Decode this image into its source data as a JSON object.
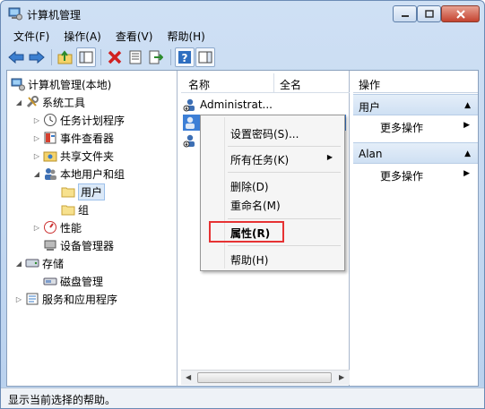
{
  "window": {
    "title": "计算机管理"
  },
  "menubar": [
    "文件(F)",
    "操作(A)",
    "查看(V)",
    "帮助(H)"
  ],
  "tree": {
    "root": "计算机管理(本地)",
    "system_tools": "系统工具",
    "task_scheduler": "任务计划程序",
    "event_viewer": "事件查看器",
    "shared_folders": "共享文件夹",
    "local_users": "本地用户和组",
    "users": "用户",
    "groups": "组",
    "performance": "性能",
    "device_manager": "设备管理器",
    "storage": "存储",
    "disk_management": "磁盘管理",
    "services_apps": "服务和应用程序"
  },
  "list": {
    "col_name": "名称",
    "col_fullname": "全名",
    "rows": [
      "Administrat..."
    ]
  },
  "actions": {
    "header": "操作",
    "section1": "用户",
    "section1_more": "更多操作",
    "section2": "Alan",
    "section2_more": "更多操作"
  },
  "context_menu": {
    "set_password": "设置密码(S)...",
    "all_tasks": "所有任务(K)",
    "delete": "删除(D)",
    "rename": "重命名(M)",
    "properties": "属性(R)",
    "help": "帮助(H)"
  },
  "statusbar": {
    "text": "显示当前选择的帮助。"
  }
}
